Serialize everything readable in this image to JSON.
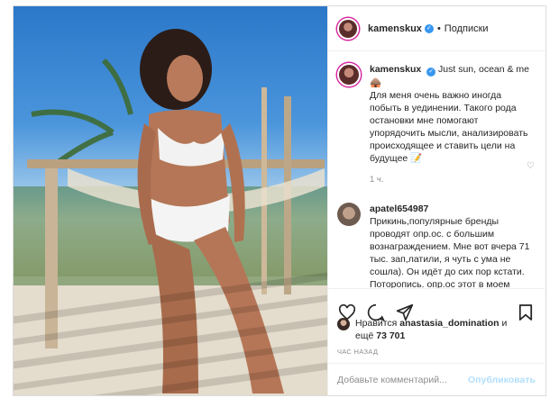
{
  "post": {
    "username": "kamenskux",
    "follow_label": "Подписки",
    "caption_short": "Just sun, ocean & me",
    "caption_emoji": "🛖",
    "caption_body": "Для меня очень важно иногда побыть в уединении. Такого рода остановки мне помогают упорядочить мысли, анализировать происходящее и ставить цели на будущее",
    "caption_emoji_end": "📝",
    "time": "1 ч."
  },
  "comment": {
    "username": "apatel654987",
    "text": "Прикинь,популярные бренды проводят опр.ос. с большим вознаграждением. Мне вот вчера 71 тыс. зап,латили, я чуть с ума не сошла). Он идёт до сих пор кстати. Поторопись. опр.ос этот в моем статусе есть,так что"
  },
  "likes": {
    "prefix": "Нравится",
    "user": "anastasia_domination",
    "connector": "и",
    "more_prefix": "ещё",
    "count": "73 701"
  },
  "ago_label": "ЧАС НАЗАД",
  "composer": {
    "placeholder": "Добавьте комментарий...",
    "publish_label": "Опубликовать"
  },
  "icons": {
    "like": "heart-icon",
    "comment": "comment-icon",
    "share": "share-icon",
    "save": "bookmark-icon",
    "verified": "verified-badge-icon",
    "comment_like": "small-heart-icon"
  },
  "colors": {
    "link": "#3897f0",
    "publish_disabled": "#b2dffc",
    "muted": "#8e8e8e"
  }
}
